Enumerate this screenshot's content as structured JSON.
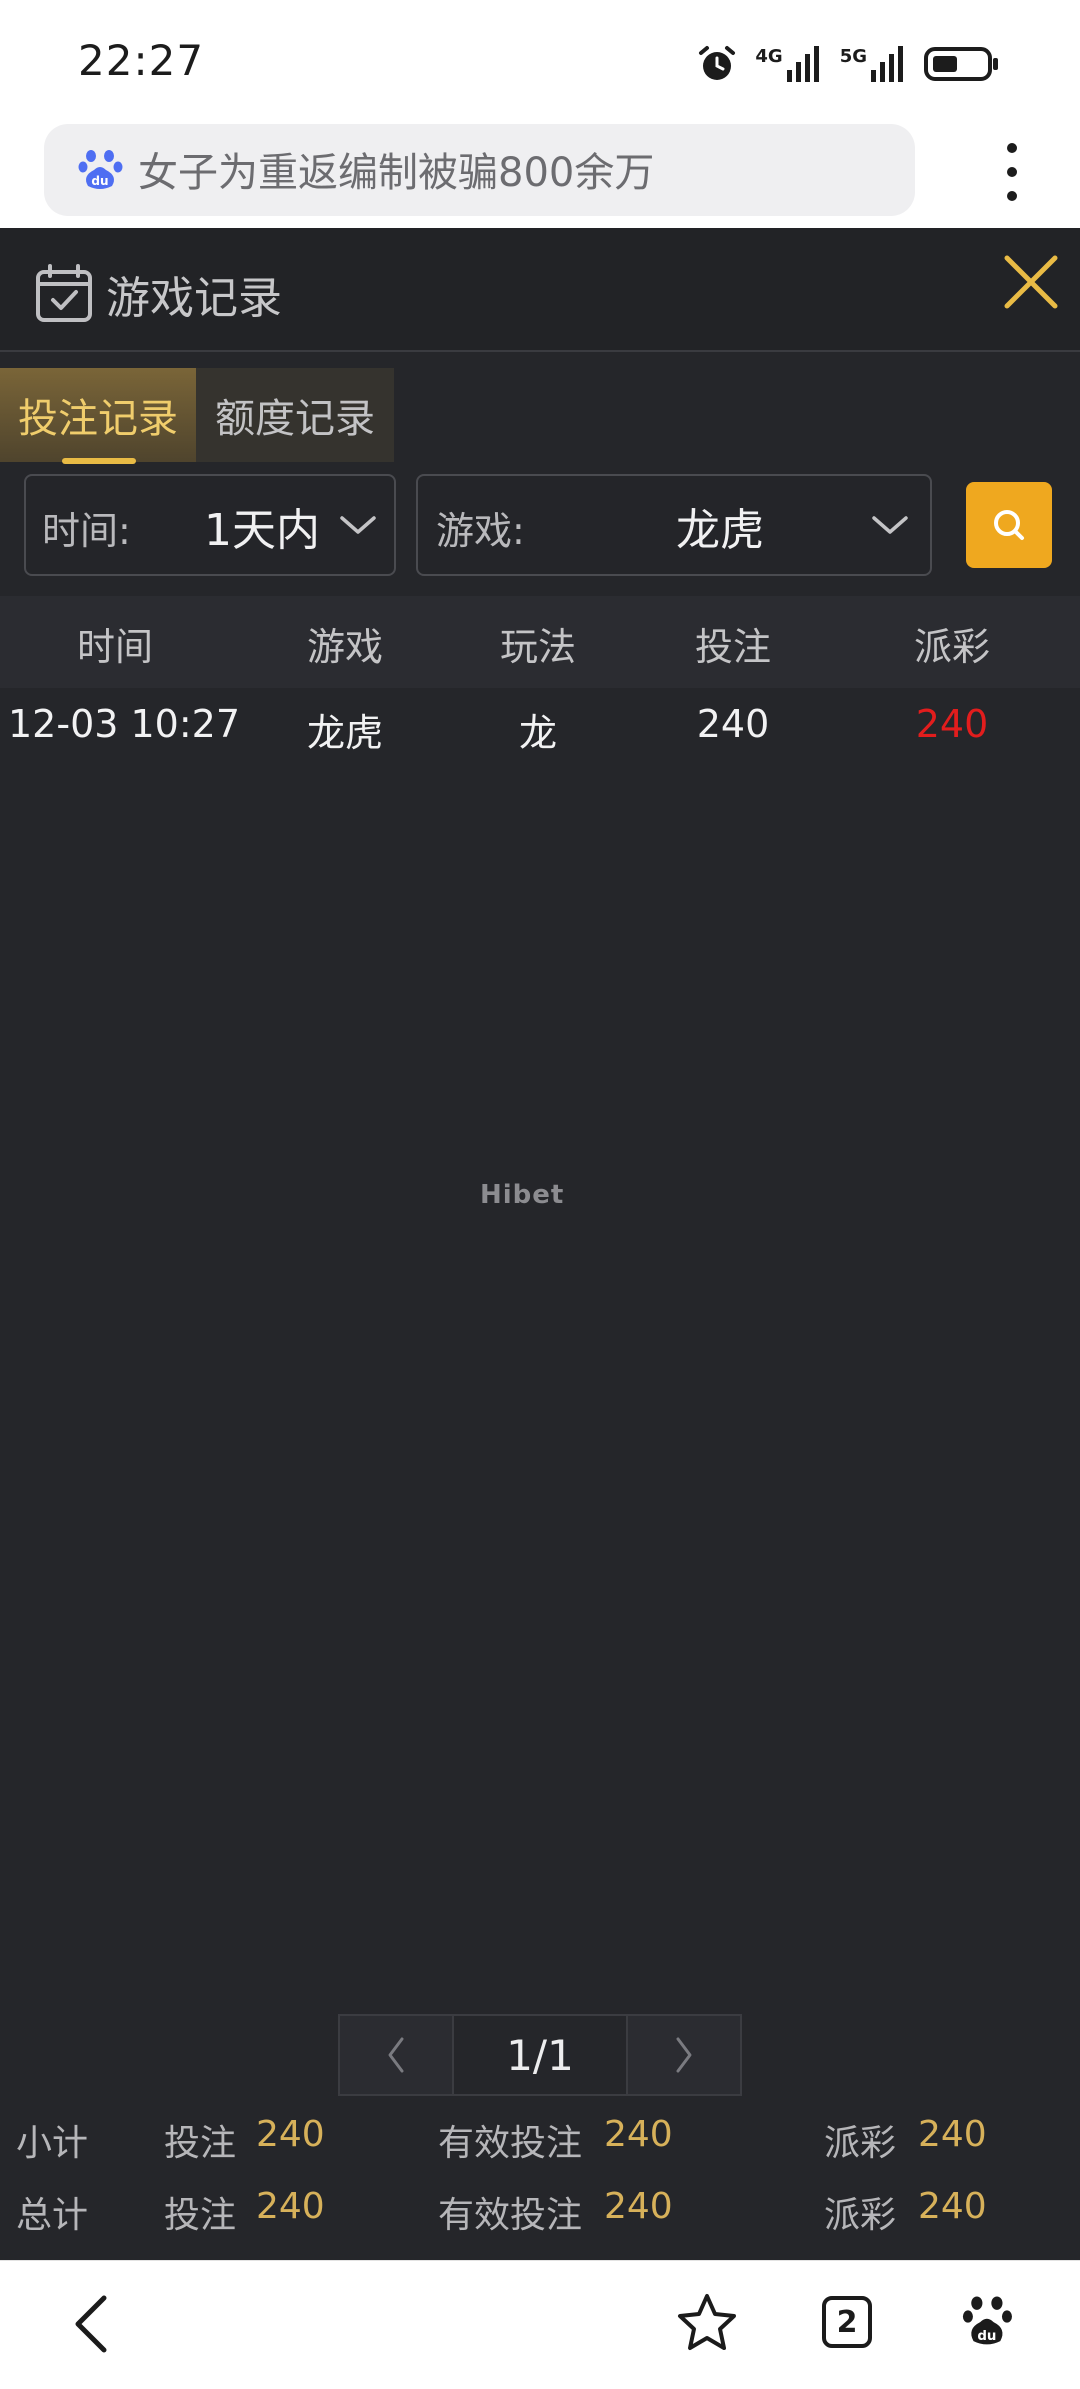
{
  "status_bar": {
    "time": "22:27",
    "alarm_icon": "alarm-icon",
    "signal_4g": "4G",
    "signal_5g": "5G",
    "battery_icon": "battery-icon"
  },
  "browser": {
    "logo_icon": "baidu-paw-icon",
    "address_text": "女子为重返编制被骗800余万",
    "menu_icon": "more-vertical-icon"
  },
  "header": {
    "title": "游戏记录",
    "title_icon": "calendar-check-icon",
    "close_icon": "close-icon"
  },
  "tabs": [
    {
      "label": "投注记录",
      "active": true
    },
    {
      "label": "额度记录",
      "active": false
    }
  ],
  "filters": {
    "time_label": "时间:",
    "time_value": "1天内",
    "game_label": "游戏:",
    "game_value": "龙虎",
    "search_icon": "search-icon"
  },
  "table": {
    "columns": [
      "时间",
      "游戏",
      "玩法",
      "投注",
      "派彩"
    ],
    "rows": [
      {
        "time": "12-03 10:27",
        "game": "龙虎",
        "play": "龙",
        "bet": "240",
        "payout": "240"
      }
    ]
  },
  "watermark": "Hibet",
  "pagination": {
    "page_text": "1/1",
    "prev_icon": "chevron-left-icon",
    "next_icon": "chevron-right-icon"
  },
  "summary": {
    "subtotal": {
      "label": "小计",
      "bet_label": "投注",
      "bet": "240",
      "valid_label": "有效投注",
      "valid": "240",
      "payout_label": "派彩",
      "payout": "240"
    },
    "total": {
      "label": "总计",
      "bet_label": "投注",
      "bet": "240",
      "valid_label": "有效投注",
      "valid": "240",
      "payout_label": "派彩",
      "payout": "240"
    }
  },
  "bottom_nav": {
    "back_icon": "back-arrow-icon",
    "star_icon": "star-icon",
    "tab_count": "2",
    "home_icon": "baidu-paw-icon"
  },
  "colors": {
    "background": "#25262a",
    "accent_gold": "#efa81f",
    "tab_active_text": "#f0cd6c",
    "payout_red": "#e21d1d",
    "summary_value": "#d7b15a"
  }
}
